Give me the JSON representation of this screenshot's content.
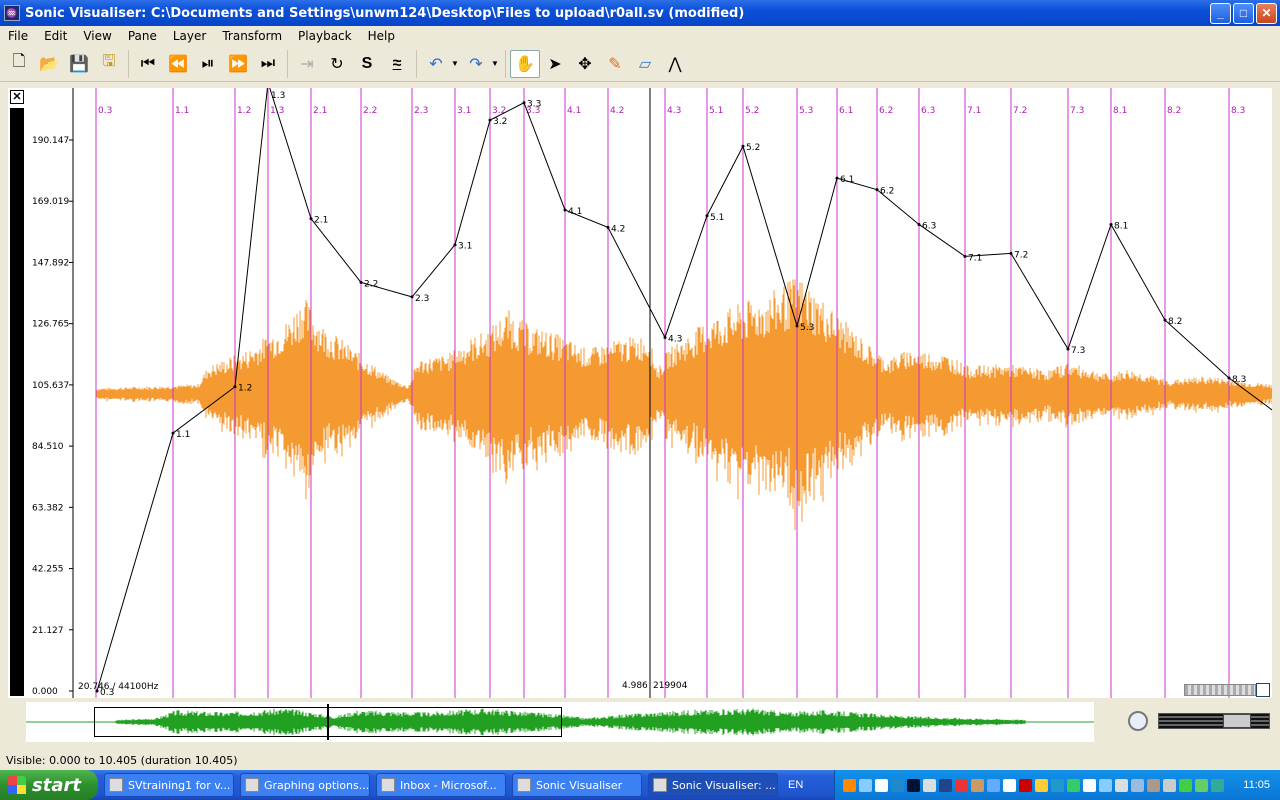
{
  "window": {
    "title": "Sonic Visualiser: C:\\Documents and Settings\\unwm124\\Desktop\\Files to upload\\r0all.sv (modified)"
  },
  "menu": [
    "File",
    "Edit",
    "View",
    "Pane",
    "Layer",
    "Transform",
    "Playback",
    "Help"
  ],
  "pane": {
    "scale_labels": [
      "190.147",
      "169.019",
      "147.892",
      "126.765",
      "105.637",
      "84.510",
      "63.382",
      "42.255",
      "21.127",
      "0.000"
    ],
    "sample_rate_label": "20.746 / 44100Hz",
    "cursor_time": "4.986",
    "cursor_frame": "219904",
    "instants": [
      "0.3",
      "1.1",
      "1.2",
      "1.3",
      "2.1",
      "2.2",
      "2.3",
      "3.1",
      "3.2",
      "3.3",
      "4.1",
      "4.2",
      "4.3",
      "5.1",
      "5.2",
      "5.3",
      "6.1",
      "6.2",
      "6.3",
      "7.1",
      "7.2",
      "7.3",
      "8.1",
      "8.2",
      "8.3"
    ],
    "curve_labels": [
      "0.3",
      "1.1",
      "1.2",
      "1.3",
      "2.1",
      "2.2",
      "2.3",
      "3.1",
      "3.2",
      "3.3",
      "4.1",
      "4.2",
      "4.3",
      "5.1",
      "5.2",
      "5.3",
      "6.1",
      "6.2",
      "6.3",
      "7.1",
      "7.2",
      "7.3",
      "8.1",
      "8.2",
      "8.3"
    ],
    "curve_values": [
      0,
      89,
      105,
      210,
      163,
      141,
      136,
      154,
      197,
      203,
      166,
      160,
      122,
      164,
      188,
      126,
      177,
      173,
      161,
      150,
      151,
      118,
      161,
      128,
      108
    ],
    "colors": {
      "instant": "#cc33cc",
      "instant_label": "#b020b0",
      "waveform": "#f59a30",
      "waveform_fill": "#fbd7b4",
      "curve": "#000000",
      "overview_wave": "#22a022"
    }
  },
  "status": {
    "visible": "Visible: 0.000 to 10.405 (duration 10.405)"
  },
  "taskbar": {
    "start": "start",
    "tasks": [
      "SVtraining1 for v...",
      "Graphing options...",
      "Inbox - Microsof...",
      "Sonic Visualiser",
      "Sonic Visualiser: ..."
    ],
    "lang": "EN",
    "clock": "11:05"
  }
}
